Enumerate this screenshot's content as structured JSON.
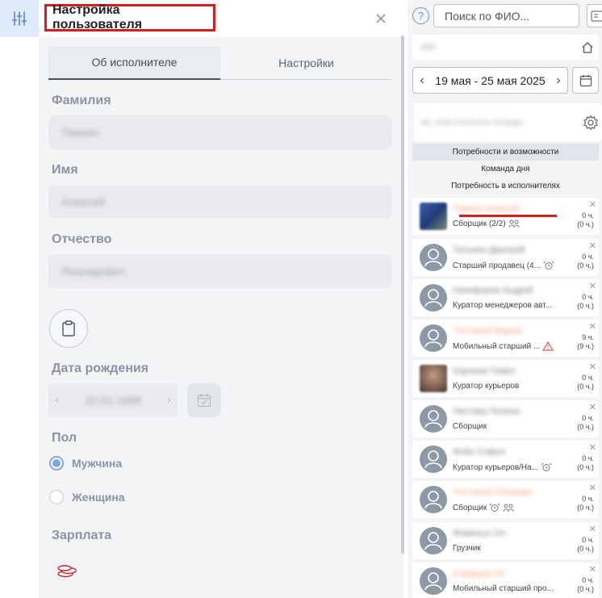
{
  "panel": {
    "title": "Настройка пользователя",
    "tabs": [
      "Об исполнителе",
      "Настройки"
    ],
    "fields": [
      {
        "label": "Фамилия",
        "value": "Тимкин"
      },
      {
        "label": "Имя",
        "value": "Алексей"
      },
      {
        "label": "Отчество",
        "value": "Леонидович"
      }
    ],
    "birth_label": "Дата рождения",
    "birth_value": "22.01.1998",
    "gender_label": "Пол",
    "gender_options": [
      "Мужчина",
      "Женщина"
    ],
    "gender_selected": "Мужчина",
    "salary_label": "Зарплата"
  },
  "right": {
    "help": "?",
    "search_placeholder": "Поиск по ФИО...",
    "store": "000",
    "week": "19 мая - 25 мая 2025",
    "filter_text": "#ID_0000 ОТКРЫТЫ СКЛАДЫ",
    "sections": [
      "Потребности и возможности",
      "Команда дня",
      "Потребность в исполнителях"
    ],
    "employees": [
      {
        "name": "Тимкин Алексей",
        "role": "Сборщик (2/2)",
        "h1": "0 ч.",
        "h2": "(0 ч.)",
        "avatar": "photo-blue",
        "name_color": "orange",
        "icon": "team-icon"
      },
      {
        "name": "Тютькин Дмитрий",
        "role": "Старший продавец (4...",
        "h1": "0 ч.",
        "h2": "(0 ч.)",
        "avatar": "default",
        "name_color": "gray",
        "icon": "alarm-icon"
      },
      {
        "name": "Никифоров Андрей",
        "role": "Куратор менеджеров авт...",
        "h1": "0 ч.",
        "h2": "(0 ч.)",
        "avatar": "default",
        "name_color": "gray",
        "icon": ""
      },
      {
        "name": "Тестовый Вадим",
        "role": "Мобильный старший ...",
        "h1": "9 ч.",
        "h2": "(9 ч.)",
        "avatar": "default",
        "name_color": "orange",
        "icon": "warning-icon"
      },
      {
        "name": "Корнеев Павел",
        "role": "Куратор курьеров",
        "h1": "0 ч.",
        "h2": "(0 ч.)",
        "avatar": "photo-brown",
        "name_color": "gray",
        "icon": ""
      },
      {
        "name": "Листова Полина",
        "role": "Сборщик",
        "h1": "0 ч.",
        "h2": "(0 ч.)",
        "avatar": "default",
        "name_color": "gray",
        "icon": ""
      },
      {
        "name": "Фобо Софья",
        "role": "Куратор курьеров/На...",
        "h1": "0 ч.",
        "h2": "(0 ч.)",
        "avatar": "default",
        "name_color": "gray",
        "icon": "alarm-icon"
      },
      {
        "name": "Тестовый Сборщик",
        "role": "Сборщик",
        "h1": "0 ч.",
        "h2": "(0 ч.)",
        "avatar": "default",
        "name_color": "orange",
        "icon": "alarm-team-icon"
      },
      {
        "name": "Фоминых Ол",
        "role": "Грузчик",
        "h1": "0 ч.",
        "h2": "(0 ч.)",
        "avatar": "default",
        "name_color": "gray",
        "icon": ""
      },
      {
        "name": "Сафаров Ол",
        "role": "Мобильный старший про...",
        "h1": "0 ч.",
        "h2": "(0 ч.)",
        "avatar": "default",
        "name_color": "orange",
        "icon": ""
      }
    ]
  },
  "colors": {
    "accent": "#7fa6e6",
    "highlight": "#d91b1b",
    "rail_active": "#dfeafb"
  }
}
